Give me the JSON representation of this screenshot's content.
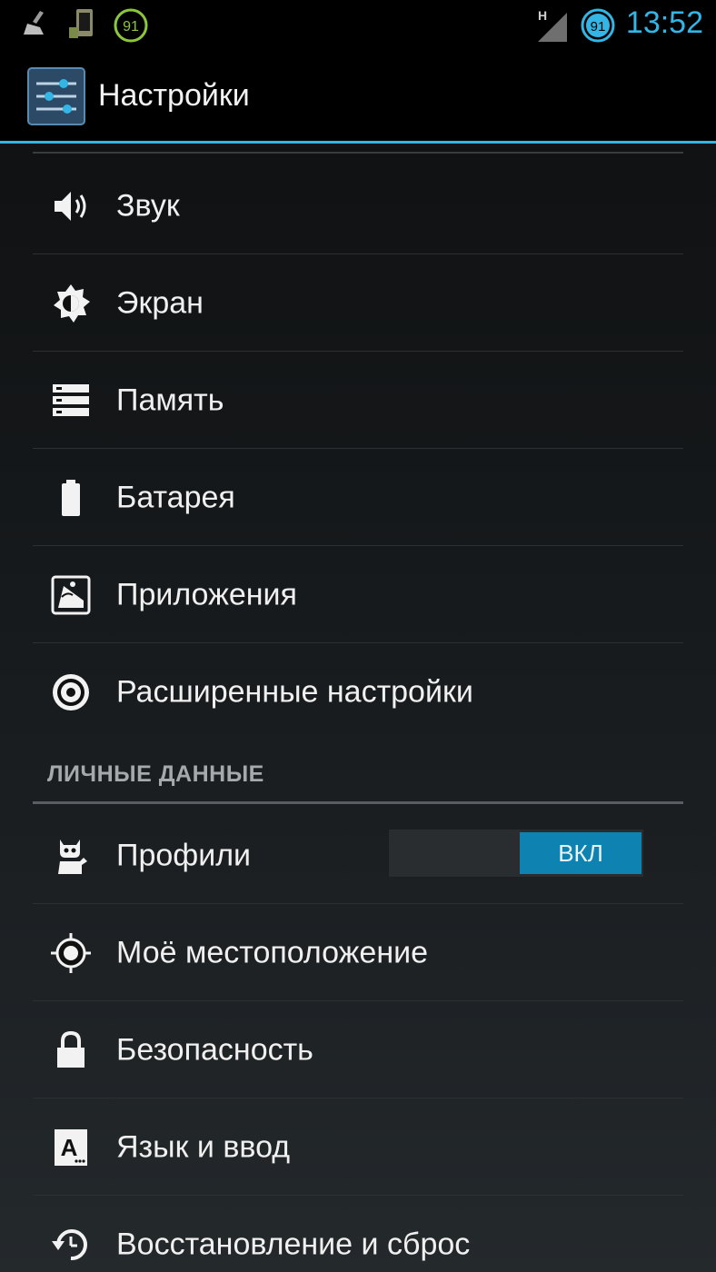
{
  "status_bar": {
    "badge_left": "91",
    "badge_right": "91",
    "network_type": "H",
    "time": "13:52"
  },
  "action_bar": {
    "title": "Настройки",
    "icon": "settings-sliders-icon"
  },
  "items_top": [
    {
      "label": "Звук",
      "icon": "volume-icon"
    },
    {
      "label": "Экран",
      "icon": "brightness-icon"
    },
    {
      "label": "Память",
      "icon": "storage-icon"
    },
    {
      "label": "Батарея",
      "icon": "battery-icon"
    },
    {
      "label": "Приложения",
      "icon": "apps-icon"
    },
    {
      "label": "Расширенные настройки",
      "icon": "advanced-settings-icon"
    }
  ],
  "section": {
    "title": "ЛИЧНЫЕ ДАННЫЕ"
  },
  "items_personal": [
    {
      "label": "Профили",
      "icon": "profiles-icon",
      "toggle": "ВКЛ"
    },
    {
      "label": "Моё местоположение",
      "icon": "location-icon"
    },
    {
      "label": "Безопасность",
      "icon": "lock-icon"
    },
    {
      "label": "Язык и ввод",
      "icon": "language-icon"
    },
    {
      "label": "Восстановление и сброс",
      "icon": "restore-icon"
    }
  ],
  "colors": {
    "accent": "#33b5e5",
    "toggle_on": "#0e82b0"
  }
}
